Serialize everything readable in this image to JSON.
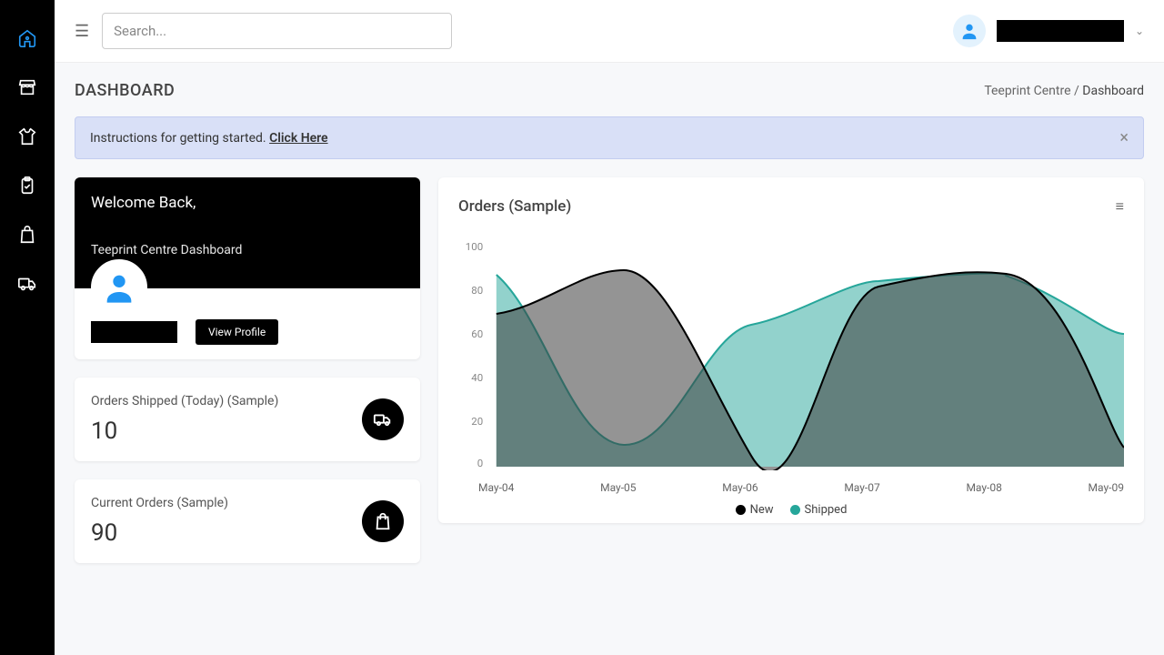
{
  "sidebar": {
    "items": [
      {
        "name": "home",
        "active": true
      },
      {
        "name": "store",
        "active": false
      },
      {
        "name": "shirt",
        "active": false
      },
      {
        "name": "clipboard",
        "active": false
      },
      {
        "name": "shopping-bag",
        "active": false
      },
      {
        "name": "truck",
        "active": false
      }
    ]
  },
  "topbar": {
    "search_placeholder": "Search..."
  },
  "page": {
    "title": "DASHBOARD",
    "breadcrumb_root": "Teeprint Centre",
    "breadcrumb_current": "Dashboard",
    "alert_text": "Instructions for getting started. ",
    "alert_link": "Click Here"
  },
  "welcome": {
    "title": "Welcome Back,",
    "subtitle": "Teeprint Centre Dashboard",
    "button": "View Profile"
  },
  "stats": [
    {
      "label": "Orders Shipped (Today) (Sample)",
      "value": "10",
      "icon": "truck"
    },
    {
      "label": "Current Orders (Sample)",
      "value": "90",
      "icon": "bag"
    }
  ],
  "chart_title": "Orders (Sample)",
  "chart_data": {
    "type": "area",
    "title": "Orders (Sample)",
    "xlabel": "",
    "ylabel": "",
    "ylim": [
      0,
      100
    ],
    "categories": [
      "May-04",
      "May-05",
      "May-06",
      "May-07",
      "May-08",
      "May-09"
    ],
    "series": [
      {
        "name": "New",
        "color": "#000000",
        "values": [
          70,
          90,
          5,
          83,
          88,
          9
        ]
      },
      {
        "name": "Shipped",
        "color": "#26a69a",
        "values": [
          86,
          10,
          64,
          85,
          88,
          60
        ]
      }
    ],
    "y_ticks": [
      0,
      20,
      40,
      60,
      80,
      100
    ]
  }
}
